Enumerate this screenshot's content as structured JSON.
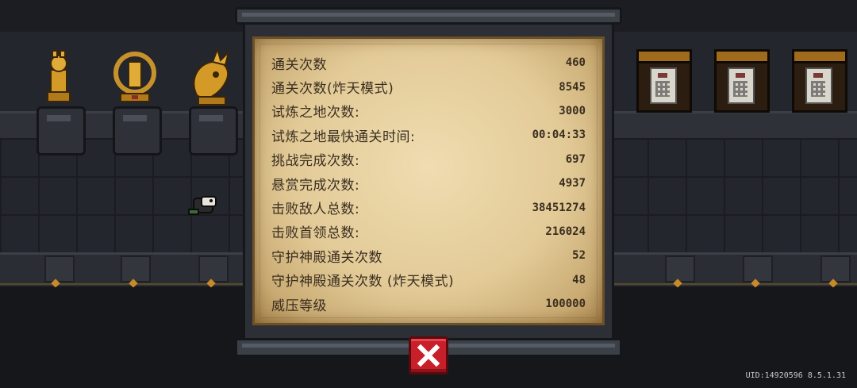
{
  "stats": {
    "rows": [
      {
        "label": "通关次数",
        "value": "460"
      },
      {
        "label": "通关次数(炸天模式)",
        "value": "8545"
      },
      {
        "label": "试炼之地次数:",
        "value": "3000"
      },
      {
        "label": "试炼之地最快通关时间:",
        "value": "00:04:33"
      },
      {
        "label": "挑战完成次数:",
        "value": "697"
      },
      {
        "label": "悬赏完成次数:",
        "value": "4937"
      },
      {
        "label": "击败敌人总数:",
        "value": "38451274"
      },
      {
        "label": "击败首领总数:",
        "value": "216024"
      },
      {
        "label": "守护神殿通关次数",
        "value": "52"
      },
      {
        "label": "守护神殿通关次数 (炸天模式)",
        "value": "48"
      },
      {
        "label": "威压等级",
        "value": "100000"
      }
    ]
  },
  "footer": {
    "uid": "UID:14920596 8.5.1.31"
  },
  "icons": {
    "close": "close-x-icon"
  },
  "colors": {
    "parchment": "#e3cb98",
    "text": "#3a2e20",
    "close_button": "#c8202a"
  }
}
